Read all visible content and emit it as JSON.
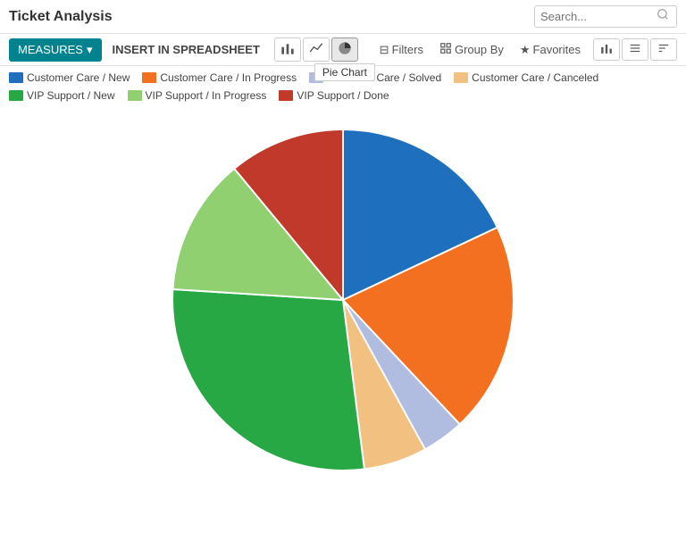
{
  "header": {
    "title": "Ticket Analysis",
    "search_placeholder": "Search..."
  },
  "toolbar": {
    "measures_label": "MEASURES",
    "insert_label": "INSERT IN SPREADSHEET",
    "filters_label": "Filters",
    "group_by_label": "Group By",
    "favorites_label": "Favorites",
    "pie_chart_tooltip": "Pie Chart"
  },
  "legend": [
    {
      "label": "Customer Care / New",
      "color": "#1F6FBF"
    },
    {
      "label": "Customer Care / In Progress",
      "color": "#F37021"
    },
    {
      "label": "Customer Care / Solved",
      "color": "#B0BDE0"
    },
    {
      "label": "Customer Care / Canceled",
      "color": "#F2C080"
    },
    {
      "label": "VIP Support / New",
      "color": "#28A745"
    },
    {
      "label": "VIP Support / In Progress",
      "color": "#90D070"
    },
    {
      "label": "VIP Support / Done",
      "color": "#C0392B"
    }
  ],
  "pie": {
    "segments": [
      {
        "label": "Customer Care / New",
        "value": 18,
        "color": "#1F6FBF"
      },
      {
        "label": "Customer Care / In Progress",
        "value": 20,
        "color": "#F37021"
      },
      {
        "label": "Customer Care / Solved",
        "value": 4,
        "color": "#B0BDE0"
      },
      {
        "label": "Customer Care / Canceled",
        "value": 6,
        "color": "#F2C080"
      },
      {
        "label": "VIP Support / New",
        "value": 28,
        "color": "#28A745"
      },
      {
        "label": "VIP Support / In Progress",
        "value": 13,
        "color": "#90D070"
      },
      {
        "label": "VIP Support / Done",
        "value": 11,
        "color": "#C0392B"
      }
    ]
  }
}
